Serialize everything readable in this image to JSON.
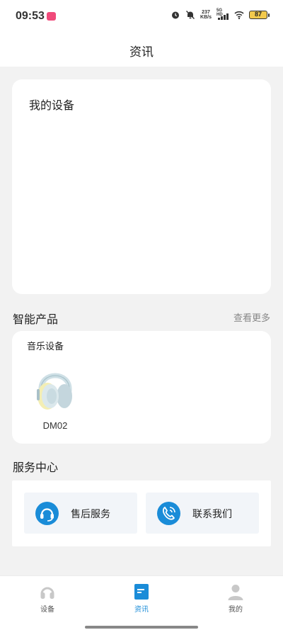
{
  "status_bar": {
    "time": "09:53",
    "net_speed_value": "237",
    "net_speed_unit": "KB/s",
    "network_label": "5G HD",
    "battery": "87",
    "icons": [
      "alarm-icon",
      "mute-icon",
      "signal-icon",
      "wifi-icon",
      "battery-icon"
    ]
  },
  "header": {
    "title": "资讯"
  },
  "my_devices": {
    "title": "我的设备"
  },
  "smart_products": {
    "title": "智能产品",
    "more_label": "查看更多",
    "category": "音乐设备",
    "items": [
      {
        "name": "DM02",
        "icon": "headphones-image"
      }
    ]
  },
  "service_center": {
    "title": "服务中心",
    "buttons": [
      {
        "label": "售后服务",
        "icon": "headset-icon"
      },
      {
        "label": "联系我们",
        "icon": "phone-icon"
      }
    ]
  },
  "tab_bar": {
    "active": "资讯",
    "tabs": [
      {
        "label": "设备",
        "icon": "headphones-icon"
      },
      {
        "label": "资讯",
        "icon": "news-icon"
      },
      {
        "label": "我的",
        "icon": "user-icon"
      }
    ]
  },
  "colors": {
    "accent": "#1a8cd8",
    "background": "#f2f2f2",
    "card": "#ffffff",
    "battery": "#f2c94c"
  }
}
